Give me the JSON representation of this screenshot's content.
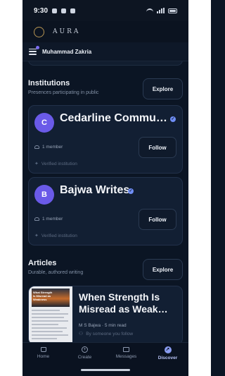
{
  "status": {
    "time": "9:30"
  },
  "brand": {
    "name": "AURA"
  },
  "user": {
    "name": "Muhammad Zakria"
  },
  "institutions": {
    "title": "Institutions",
    "subtitle": "Presences participating in public",
    "explore_label": "Explore",
    "items": [
      {
        "initial": "C",
        "name": "Cedarline Communi…",
        "members": "1 member",
        "follow_label": "Follow",
        "verified_label": "Verified institution"
      },
      {
        "initial": "B",
        "name": "Bajwa Writes",
        "members": "1 member",
        "follow_label": "Follow",
        "verified_label": "Verified institution"
      }
    ]
  },
  "articles": {
    "title": "Articles",
    "subtitle": "Durable, authored writing",
    "explore_label": "Explore",
    "items": [
      {
        "title": "When Strength Is Misread as Weak…",
        "author": "M S Bajwa",
        "read_time": "5 min read",
        "follow_note": "By someone you follow",
        "thumb_text": "What Strength Is Misread as Weakness"
      }
    ]
  },
  "tabs": [
    {
      "label": "Home",
      "icon": "home-icon"
    },
    {
      "label": "Create",
      "icon": "plus-circle-icon"
    },
    {
      "label": "Messages",
      "icon": "mail-icon"
    },
    {
      "label": "Discover",
      "icon": "compass-icon",
      "active": true
    }
  ],
  "colors": {
    "accent": "#6a5ae8",
    "verified": "#6f8ef5",
    "background": "#0b1524",
    "card": "#121f33"
  }
}
